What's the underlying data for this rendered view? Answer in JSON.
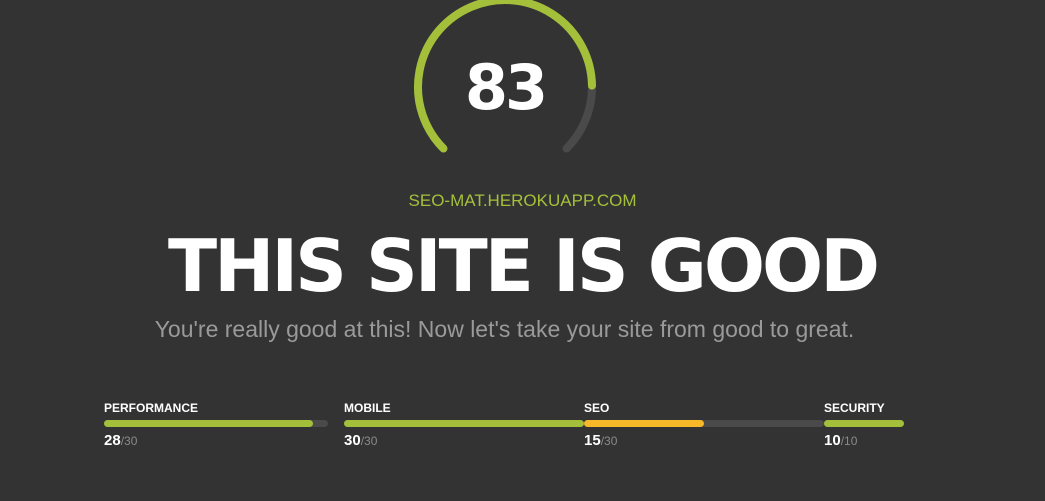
{
  "gauge": {
    "score": "83",
    "score_value": 83,
    "max": 100,
    "fill_color": "#a4c03a",
    "track_color": "#4a4a4a"
  },
  "domain": "SEO-MAT.HEROKUAPP.COM",
  "headline": "THIS SITE IS GOOD",
  "subtitle": "You're really good at this! Now let's take your site from good to great.",
  "metrics": [
    {
      "label": "PERFORMANCE",
      "score": "28",
      "max_label": "/30",
      "value": 28,
      "max": 30,
      "color": "#a4c03a"
    },
    {
      "label": "MOBILE",
      "score": "30",
      "max_label": "/30",
      "value": 30,
      "max": 30,
      "color": "#a4c03a"
    },
    {
      "label": "SEO",
      "score": "15",
      "max_label": "/30",
      "value": 15,
      "max": 30,
      "color": "#f7b928"
    },
    {
      "label": "SECURITY",
      "score": "10",
      "max_label": "/10",
      "value": 10,
      "max": 10,
      "color": "#a4c03a"
    }
  ],
  "colors": {
    "background": "#333333",
    "accent": "#a4c03a",
    "warning": "#f7b928",
    "text": "#ffffff",
    "muted": "#9a9a9a"
  }
}
